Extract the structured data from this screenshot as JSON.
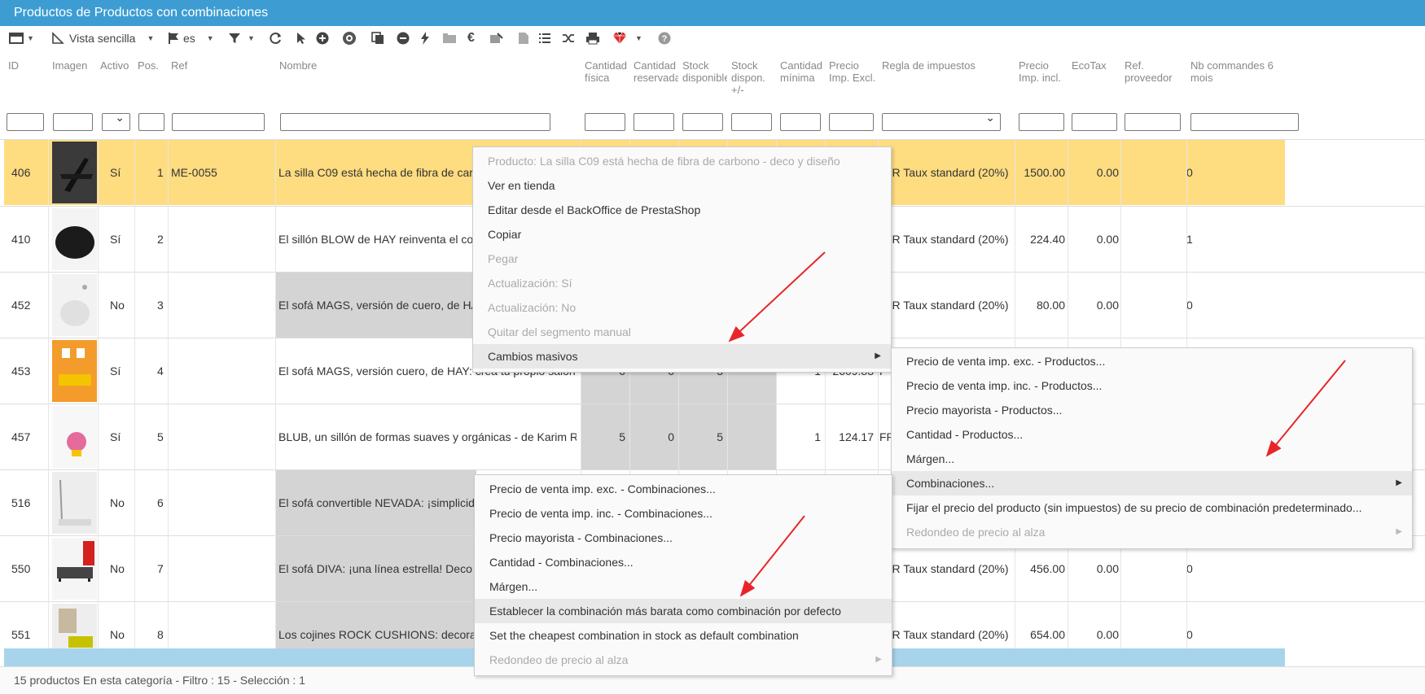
{
  "window": {
    "title": "Productos de Productos con combinaciones"
  },
  "toolbar": {
    "view_label": "Vista sencilla",
    "lang_label": "es"
  },
  "columns": [
    "ID",
    "Imagen",
    "Activo",
    "Pos.",
    "Ref",
    "Nombre",
    "Cantidad física",
    "Cantidad reservada",
    "Stock disponible",
    "Stock dispon. +/-",
    "Cantidad mínima",
    "Precio Imp. Excl.",
    "Regla de impuestos",
    "Precio Imp. incl.",
    "EcoTax",
    "Ref. proveedor",
    "Nb commandes 6 mois"
  ],
  "rows": [
    {
      "id": "406",
      "active": "Sí",
      "pos": "1",
      "ref": "ME-0055",
      "name": "La silla C09 está hecha de fibra de carbono - deco y diseño",
      "tax": "FR Taux standard (20%)",
      "price_incl": "1500.00",
      "ecotax": "0.00",
      "orders": "0"
    },
    {
      "id": "410",
      "active": "Sí",
      "pos": "2",
      "ref": "",
      "name": "El sillón BLOW de HAY reinventa el confort",
      "tax": "FR Taux standard (20%)",
      "price_incl": "224.40",
      "ecotax": "0.00",
      "orders": "1"
    },
    {
      "id": "452",
      "active": "No",
      "pos": "3",
      "ref": "",
      "name": "El sofá MAGS, versión de cuero, de HAY",
      "tax": "FR Taux standard (20%)",
      "price_incl": "80.00",
      "ecotax": "0.00",
      "orders": "0"
    },
    {
      "id": "453",
      "active": "Sí",
      "pos": "4",
      "ref": "",
      "name": "El sofá MAGS, versión cuero, de HAY: crea tu propio salón",
      "qty": "0",
      "reserved": "0",
      "available": "5",
      "minimum": "1",
      "price_excl": "2609.83",
      "tax": "F"
    },
    {
      "id": "457",
      "active": "Sí",
      "pos": "5",
      "ref": "",
      "name": "BLUB, un sillón de formas suaves y orgánicas - de Karim Rashid",
      "qty": "5",
      "reserved": "0",
      "available": "5",
      "minimum": "1",
      "price_excl": "124.17",
      "tax": "FR"
    },
    {
      "id": "516",
      "active": "No",
      "pos": "6",
      "ref": "",
      "name": "El sofá convertible NEVADA: ¡simplicidad!"
    },
    {
      "id": "550",
      "active": "No",
      "pos": "7",
      "ref": "",
      "name": "El sofá DIVA: ¡una línea estrella! Deco",
      "tax": "FR Taux standard (20%)",
      "price_incl": "456.00",
      "ecotax": "0.00",
      "orders": "0"
    },
    {
      "id": "551",
      "active": "No",
      "pos": "8",
      "ref": "",
      "name": "Los cojines ROCK CUSHIONS: decorativos",
      "tax": "FR Taux standard (20%)",
      "price_incl": "654.00",
      "ecotax": "0.00",
      "orders": "0"
    }
  ],
  "footer": {
    "status": "15 productos En esta categoría - Filtro : 15 - Selección : 1"
  },
  "context_menu": {
    "items": [
      "Producto: La silla C09 está hecha de fibra de carbono - deco y diseño",
      "Ver en tienda",
      "Editar desde el BackOffice de PrestaShop",
      "Copiar",
      "Pegar",
      "Actualización: Sí",
      "Actualización: No",
      "Quitar del segmento manual",
      "Cambios masivos"
    ]
  },
  "submenu_masivos": {
    "items": [
      "Precio de venta imp. exc. - Productos...",
      "Precio de venta imp. inc. - Productos...",
      "Precio mayorista - Productos...",
      "Cantidad - Productos...",
      "Márgen...",
      "Combinaciones...",
      "Fijar el precio del producto (sin impuestos) de su precio de combinación predeterminado...",
      "Redondeo de precio al alza"
    ]
  },
  "submenu_combinaciones": {
    "items": [
      "Precio de venta imp. exc. - Combinaciones...",
      "Precio de venta imp. inc. - Combinaciones...",
      "Precio mayorista - Combinaciones...",
      "Cantidad - Combinaciones...",
      "Márgen...",
      "Establecer la combinación más barata como combinación por defecto",
      "Set the cheapest combination in stock as default combination",
      "Redondeo de precio al alza"
    ]
  },
  "colors": {
    "title_bar": "#3d9dd3",
    "selected_row": "#fedc80",
    "annotation_arrow": "#e8262a"
  }
}
